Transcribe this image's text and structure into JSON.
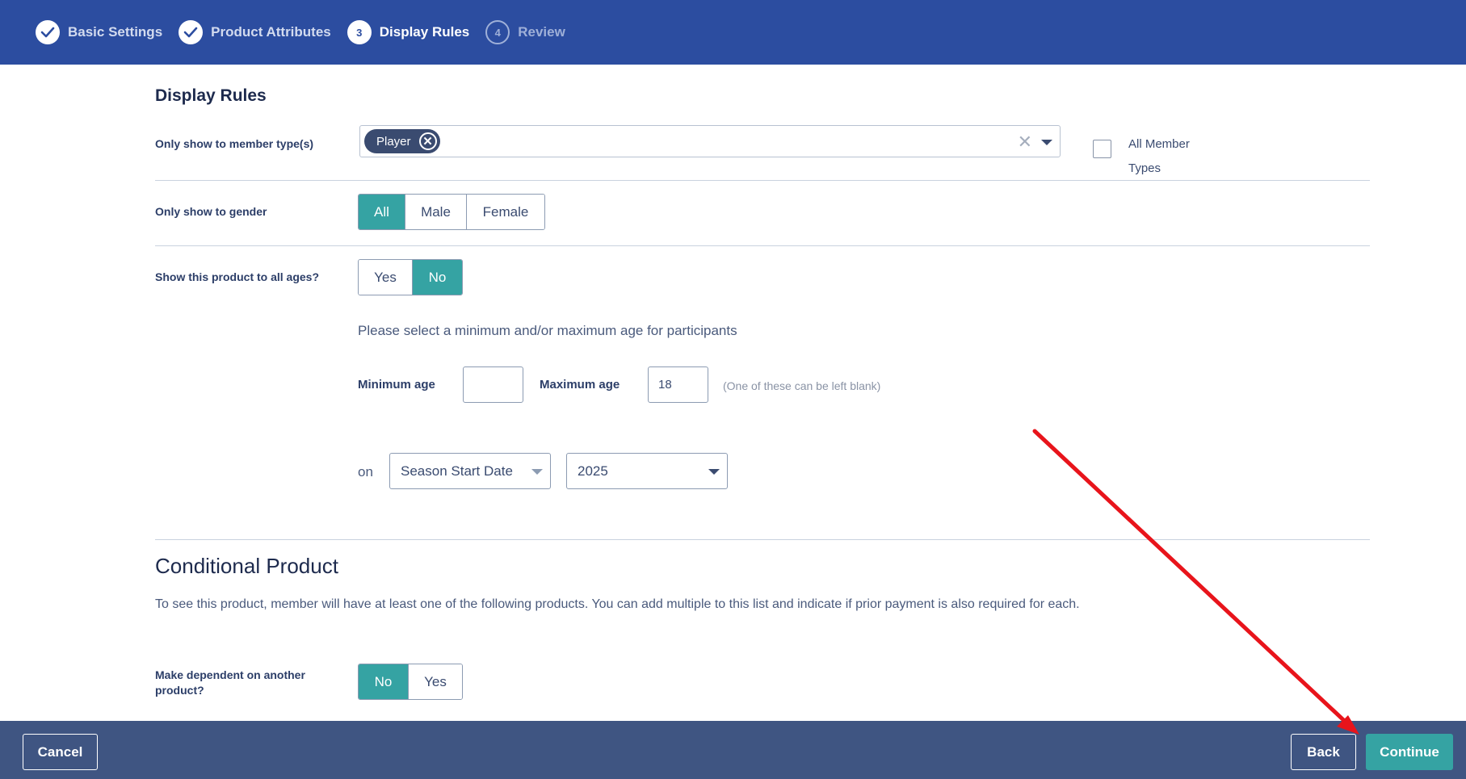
{
  "stepper": {
    "steps": [
      {
        "label": "Basic Settings",
        "status": "done",
        "marker": "✓"
      },
      {
        "label": "Product Attributes",
        "status": "done",
        "marker": "✓"
      },
      {
        "label": "Display Rules",
        "status": "current",
        "marker": "3"
      },
      {
        "label": "Review",
        "status": "todo",
        "marker": "4"
      }
    ]
  },
  "display_rules": {
    "title": "Display Rules",
    "member_types": {
      "label": "Only show to member type(s)",
      "selected_chip": "Player",
      "chip_remove": "✕",
      "clear": "✕",
      "all_types_label": "All Member Types",
      "all_types_checked": false
    },
    "gender": {
      "label": "Only show to gender",
      "options": [
        "All",
        "Male",
        "Female"
      ],
      "selected": "All"
    },
    "all_ages": {
      "label": "Show this product to all ages?",
      "options": [
        "Yes",
        "No"
      ],
      "selected": "No"
    },
    "age_hint": "Please select a minimum and/or maximum age for participants",
    "min_age_label": "Minimum age",
    "min_age_value": "",
    "max_age_label": "Maximum age",
    "max_age_value": "18",
    "age_note": "(One of these can be left blank)",
    "on_label": "on",
    "date_select": "Season Start Date",
    "year_select": "2025"
  },
  "conditional_product": {
    "title": "Conditional Product",
    "description": "To see this product, member will have at least one of the following products. You can add multiple to this list and indicate if prior payment is also required for each.",
    "dependent_label": "Make dependent on another product?",
    "options": [
      "No",
      "Yes"
    ],
    "selected": "No"
  },
  "footer": {
    "cancel": "Cancel",
    "back": "Back",
    "continue": "Continue"
  },
  "colors": {
    "header": "#2c4da0",
    "footer": "#3f5582",
    "accent": "#35a3a3",
    "annotation_arrow": "#e8141b"
  }
}
